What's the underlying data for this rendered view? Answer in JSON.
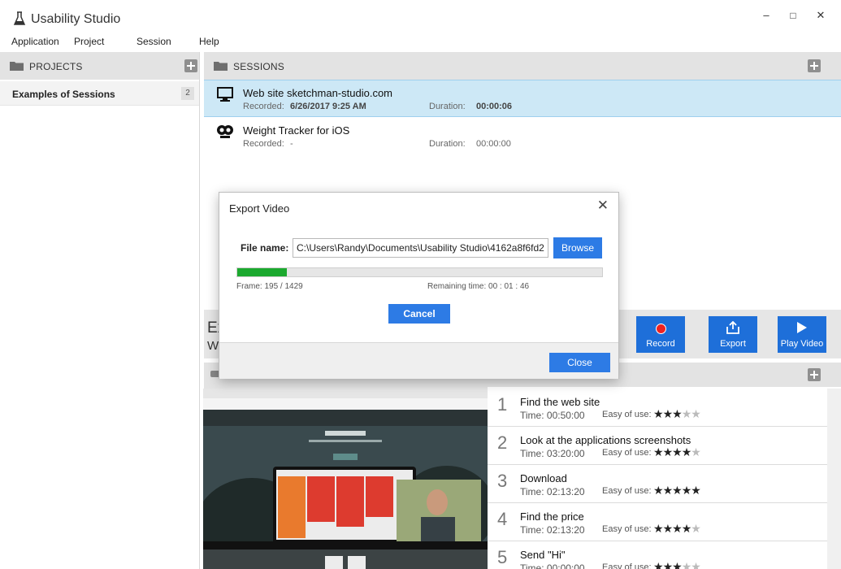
{
  "app": {
    "title": "Usability Studio",
    "window_controls": {
      "minimize": "–",
      "maximize": "□",
      "close": "✕"
    }
  },
  "menu": [
    "Application",
    "Project",
    "Session",
    "Help"
  ],
  "projects": {
    "header": "PROJECTS",
    "items": [
      {
        "name": "Examples of Sessions",
        "count": "2"
      }
    ]
  },
  "sessions": {
    "header": "SESSIONS",
    "items": [
      {
        "title": "Web site sketchman-studio.com",
        "recorded_label": "Recorded:",
        "recorded": "6/26/2017 9:25 AM",
        "duration_label": "Duration:",
        "duration": "00:00:06",
        "icon": "monitor-icon"
      },
      {
        "title": "Weight Tracker for iOS",
        "recorded_label": "Recorded:",
        "recorded": "-",
        "duration_label": "Duration:",
        "duration": "00:00:00",
        "icon": "webcam-icon"
      }
    ]
  },
  "detail": {
    "title_partial": "Ex",
    "subtitle_partial": "W",
    "actions": {
      "record": "Record",
      "export": "Export",
      "play": "Play Video"
    }
  },
  "tasks": [
    {
      "num": "1",
      "name": "Find the web site",
      "time": "Time: 00:50:00",
      "ease_label": "Easy of use:",
      "stars": 3
    },
    {
      "num": "2",
      "name": "Look at the applications screenshots",
      "time": "Time: 03:20:00",
      "ease_label": "Easy of use:",
      "stars": 4
    },
    {
      "num": "3",
      "name": "Download",
      "time": "Time: 02:13:20",
      "ease_label": "Easy of use:",
      "stars": 5
    },
    {
      "num": "4",
      "name": "Find the price",
      "time": "Time: 02:13:20",
      "ease_label": "Easy of use:",
      "stars": 4
    },
    {
      "num": "5",
      "name": "Send \"Hi\"",
      "time": "Time: 00:00:00",
      "ease_label": "Easy of use:",
      "stars": 3
    }
  ],
  "dialog": {
    "title": "Export Video",
    "close": "✕",
    "file_label": "File name:",
    "file_value": "C:\\Users\\Randy\\Documents\\Usability Studio\\4162a8f6fd2a",
    "browse": "Browse",
    "progress": 0.136,
    "frame_text": "Frame: 195 / 1429",
    "remaining_text": "Remaining time: 00 : 01 : 46",
    "cancel": "Cancel",
    "close_button": "Close"
  },
  "colors": {
    "accent": "#2d7be5",
    "selection": "#cde8f6",
    "progress": "#1ca92f"
  }
}
